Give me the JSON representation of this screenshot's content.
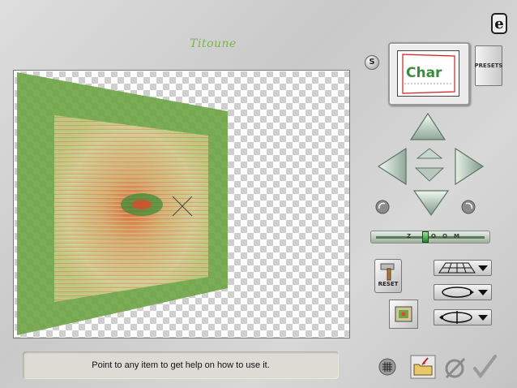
{
  "app": {
    "brand": "Titoune",
    "logo_letter": "e",
    "help_text": "Point to any item to get help on how to use it."
  },
  "preview": {
    "s_label": "S",
    "thumbnail_text": "Char",
    "presets_label": "PRESETS"
  },
  "zoom_slider": {
    "letters": [
      "Z",
      "O",
      "O",
      "M"
    ],
    "level": 0.45
  },
  "buttons": {
    "reset_label": "RESET"
  },
  "dropdowns": [
    {
      "name": "perspective-grid-dropdown",
      "icon": "perspective-grid-icon"
    },
    {
      "name": "rotate-ellipse-dropdown",
      "icon": "ellipse-arrows-icon"
    },
    {
      "name": "flip-rotate-dropdown",
      "icon": "flip-rotate-icon"
    }
  ],
  "colors": {
    "brand": "#7fb24a",
    "green_frame": "#6fa647",
    "slider_thumb": "#2e9c3c"
  }
}
